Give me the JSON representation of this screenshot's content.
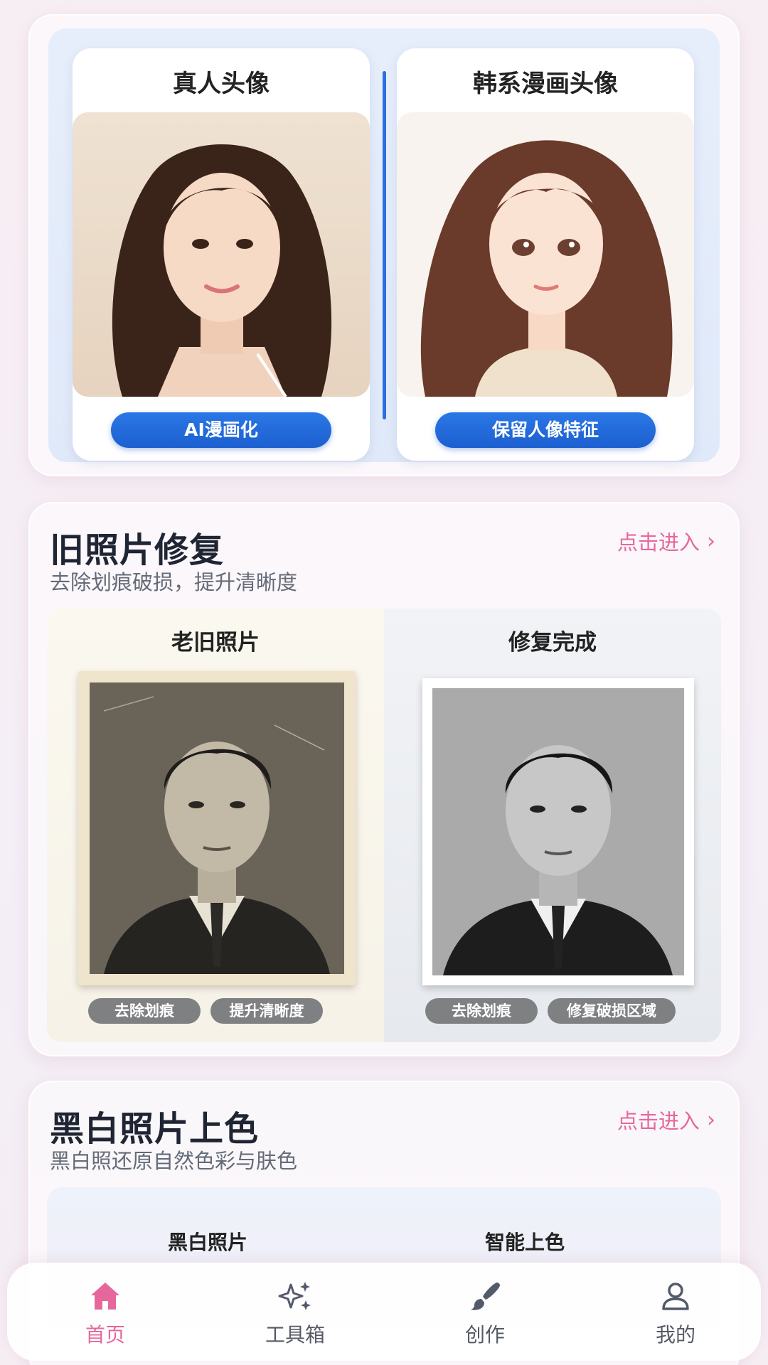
{
  "anime_card": {
    "left_title": "真人头像",
    "right_title": "韩系漫画头像",
    "left_button": "AI漫画化",
    "right_button": "保留人像特征"
  },
  "repair_card": {
    "title": "旧照片修复",
    "subtitle": "去除划痕破损，提升清晰度",
    "enter_label": "点击进入",
    "before_title": "老旧照片",
    "after_title": "修复完成",
    "before_tags": [
      "去除划痕",
      "提升清晰度"
    ],
    "after_tags": [
      "去除划痕",
      "修复破损区域"
    ]
  },
  "color_card": {
    "title": "黑白照片上色",
    "subtitle": "黑白照还原自然色彩与肤色",
    "enter_label": "点击进入",
    "before_title": "黑白照片",
    "after_title": "智能上色"
  },
  "nav": {
    "items": [
      {
        "label": "首页",
        "icon": "home-icon",
        "active": true
      },
      {
        "label": "工具箱",
        "icon": "sparkle-icon",
        "active": false
      },
      {
        "label": "创作",
        "icon": "brush-icon",
        "active": false
      },
      {
        "label": "我的",
        "icon": "user-icon",
        "active": false
      }
    ]
  },
  "colors": {
    "accent_pink": "#e6689c",
    "button_blue": "#1c5fd0",
    "divider_blue": "#2a6fe0"
  }
}
